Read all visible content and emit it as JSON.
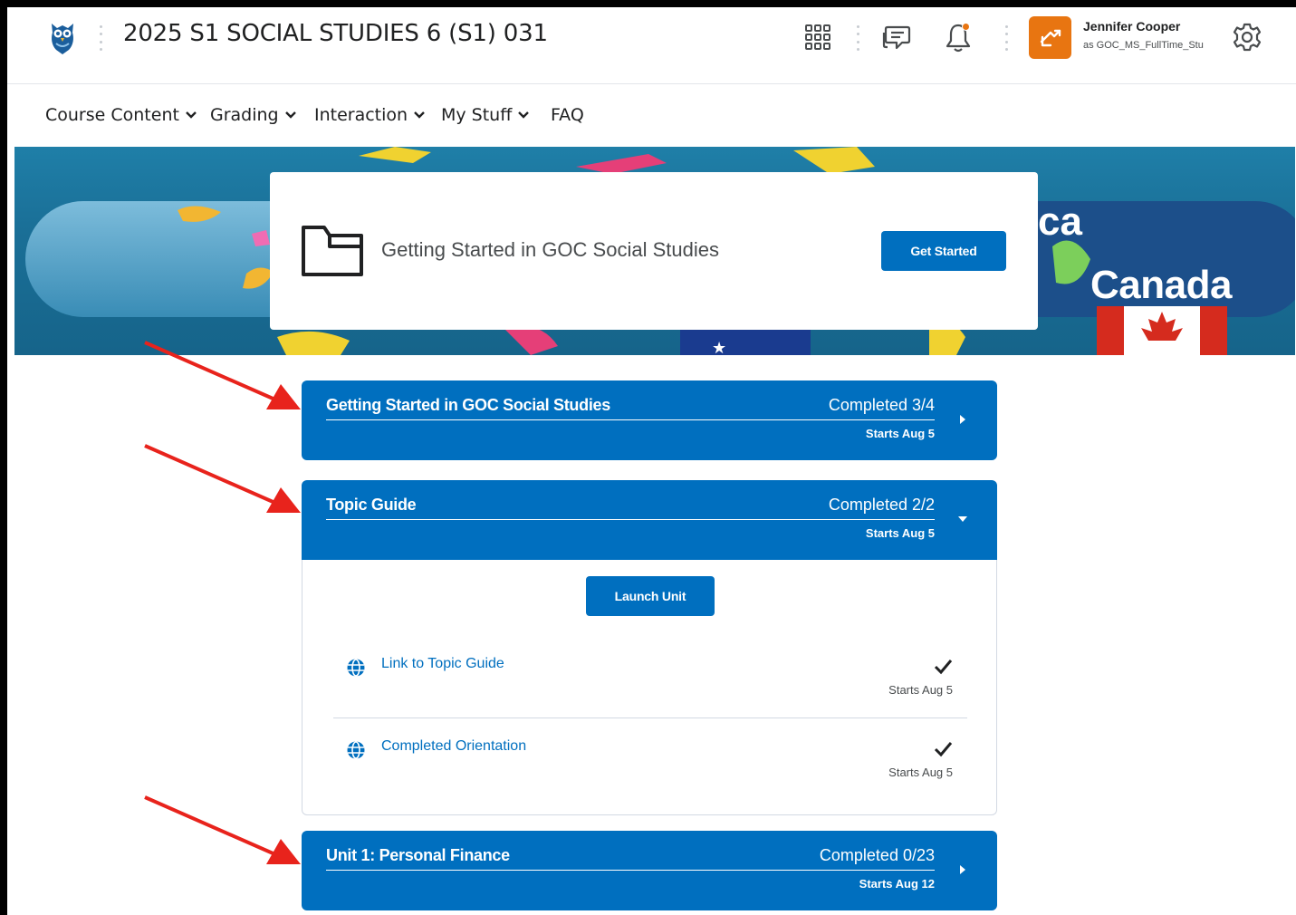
{
  "header": {
    "course_title": "2025 S1 SOCIAL STUDIES 6 (S1) 031",
    "user_name": "Jennifer Cooper",
    "user_role": "as GOC_MS_FullTime_Stu",
    "accent_color": "#e87511"
  },
  "nav": {
    "items": [
      {
        "label": "Course Content",
        "has_dropdown": true
      },
      {
        "label": "Grading",
        "has_dropdown": true
      },
      {
        "label": "Interaction",
        "has_dropdown": true
      },
      {
        "label": "My Stuff",
        "has_dropdown": true
      },
      {
        "label": "FAQ",
        "has_dropdown": false
      }
    ]
  },
  "banner": {
    "text_fragment": "ca",
    "country_label": "Canada"
  },
  "hero": {
    "icon": "folder-icon",
    "title": "Getting Started in GOC Social Studies",
    "button_label": "Get Started"
  },
  "units": [
    {
      "title": "Getting Started in GOC Social Studies",
      "progress": "Completed 3/4",
      "start": "Starts Aug 5",
      "expanded": false
    },
    {
      "title": "Topic Guide",
      "progress": "Completed 2/2",
      "start": "Starts Aug 5",
      "expanded": true,
      "launch_label": "Launch Unit",
      "topics": [
        {
          "label": "Link to Topic Guide",
          "start": "Starts Aug 5",
          "completed": true,
          "icon": "globe-icon"
        },
        {
          "label": "Completed Orientation",
          "start": "Starts Aug 5",
          "completed": true,
          "icon": "globe-icon"
        }
      ]
    },
    {
      "title": "Unit 1: Personal Finance",
      "progress": "Completed 0/23",
      "start": "Starts Aug 12",
      "expanded": false
    }
  ],
  "colors": {
    "primary": "#006fbf",
    "annotation_arrow": "#e8231c"
  }
}
